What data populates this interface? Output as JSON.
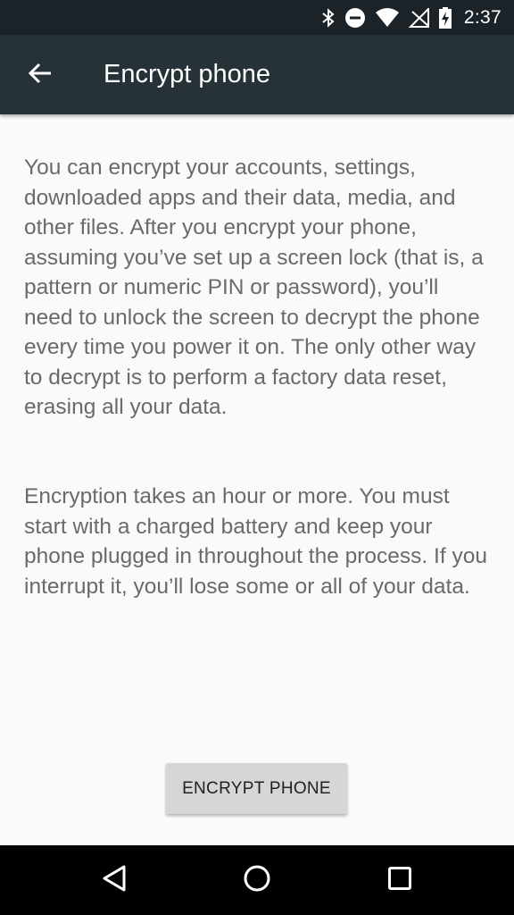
{
  "status_bar": {
    "time": "2:37",
    "icons": [
      "bluetooth-icon",
      "do-not-disturb-icon",
      "wifi-icon",
      "signal-off-icon",
      "battery-charging-icon"
    ]
  },
  "app_bar": {
    "title": "Encrypt phone",
    "back_icon": "arrow-back-icon"
  },
  "content": {
    "paragraph_1": "You can encrypt your accounts, settings, downloaded apps and their data, media, and other files. After you encrypt your phone, assuming you’ve set up a screen lock (that is, a pattern or numeric PIN or password), you’ll need to unlock the screen to decrypt the phone every time you power it on. The only other way to decrypt is to perform a factory data reset, erasing all your data.",
    "paragraph_2": "Encryption takes an hour or more. You must start with a charged battery and keep your phone plugged in throughout the process. If you interrupt it, you’ll lose some or all of your data.",
    "button_label": "ENCRYPT PHONE"
  },
  "nav_bar": {
    "icons": [
      "nav-back-icon",
      "nav-home-icon",
      "nav-recents-icon"
    ]
  },
  "colors": {
    "status_bar_bg": "#1b2328",
    "app_bar_bg": "#263238",
    "content_bg": "#fafafa",
    "body_text": "#6a6a6a",
    "button_bg": "#d6d6d6",
    "nav_bar_bg": "#000000"
  }
}
